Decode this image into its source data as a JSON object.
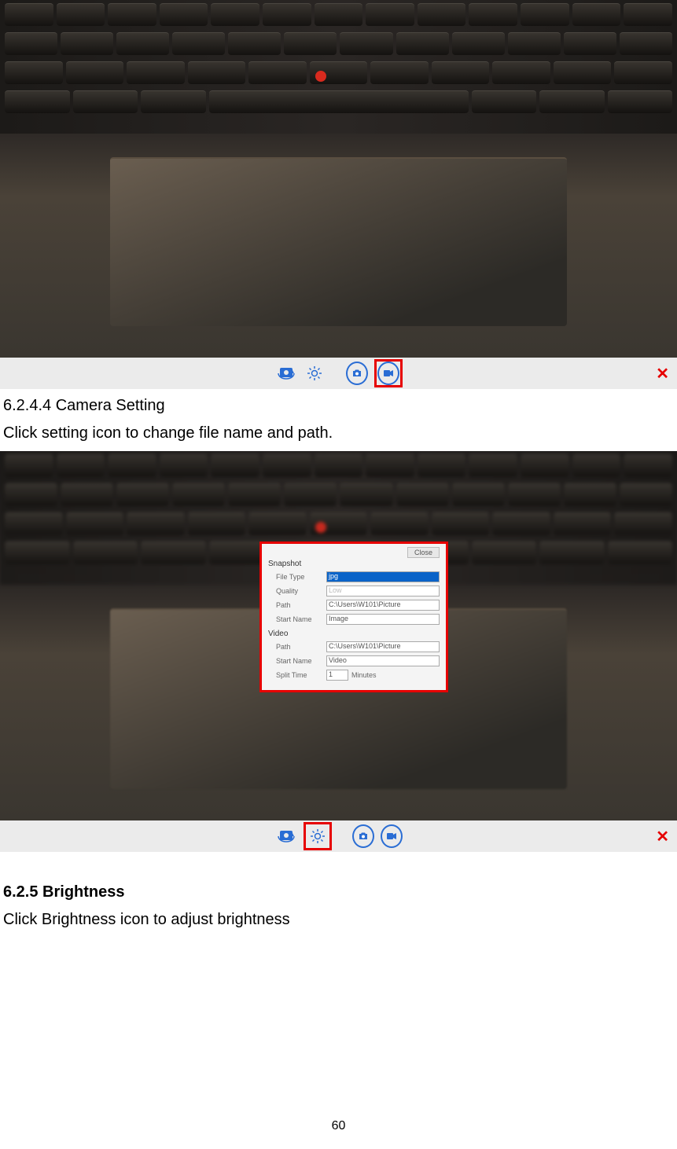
{
  "section1": {
    "heading": "6.2.4.4 Camera Setting",
    "text": "Click setting icon to change file name and path."
  },
  "section2": {
    "heading": "6.2.5 Brightness",
    "text": "Click Brightness icon to adjust brightness"
  },
  "settings_dialog": {
    "close": "Close",
    "snapshot": {
      "title": "Snapshot",
      "file_type_label": "File Type",
      "file_type_value": "jpg",
      "quality_label": "Quality",
      "quality_value": "Low",
      "path_label": "Path",
      "path_value": "C:\\Users\\W101\\Picture",
      "start_name_label": "Start Name",
      "start_name_value": "Image"
    },
    "video": {
      "title": "Video",
      "path_label": "Path",
      "path_value": "C:\\Users\\W101\\Picture",
      "start_name_label": "Start Name",
      "start_name_value": "Video",
      "split_time_label": "Split Time",
      "split_time_value": "1",
      "split_time_unit": "Minutes"
    }
  },
  "page_number": "60"
}
